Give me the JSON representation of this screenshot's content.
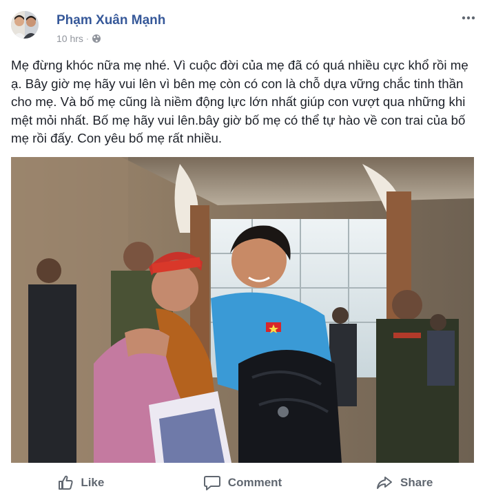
{
  "post": {
    "author": "Phạm Xuân Mạnh",
    "timestamp": "10 hrs",
    "separator": "·",
    "privacy_icon": "globe-icon",
    "more_icon": "more-dots-icon",
    "text": "Mẹ đừng khóc nữa mẹ nhé. Vì cuộc đời của mẹ đã có quá nhiều cực khổ rồi mẹ ạ. Bây giờ mẹ hãy vui lên vì bên mẹ còn có con là chỗ dựa vững chắc tinh thần cho mẹ. Và bố mẹ cũng là niềm động lực lớn nhất giúp con vượt qua những khi mệt mỏi nhất. Bố mẹ hãy vui lên.bây giờ bố mẹ có thể tự hào về con trai của bố mẹ rồi đấy. Con yêu bố mẹ rất nhiều."
  },
  "actions": [
    {
      "label": "Like",
      "icon": "thumbs-up-icon"
    },
    {
      "label": "Comment",
      "icon": "comment-bubble-icon"
    },
    {
      "label": "Share",
      "icon": "share-arrow-icon"
    }
  ],
  "colors": {
    "author_link": "#365899",
    "meta_text": "#90949c",
    "action_text": "#606770",
    "body_text": "#1d2129"
  }
}
